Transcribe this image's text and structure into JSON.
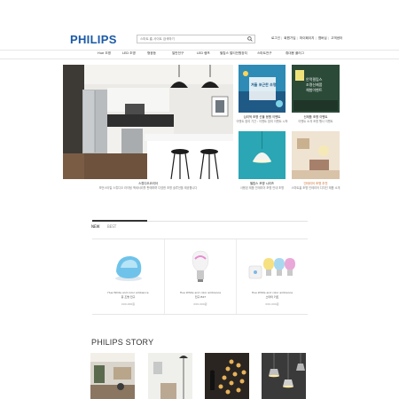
{
  "header": {
    "logo": "PHILIPS",
    "search_placeholder": "스마트 홈 사이트 검색하기",
    "util_links": [
      "로그인",
      "회원가입",
      "마이페이지",
      "멤버십",
      "고객센터"
    ]
  },
  "nav": {
    "items": [
      "Hue 조명",
      "LED 조명",
      "형광등",
      "일반전구",
      "LED 램프",
      "필립스 멀티전원장치",
      "스마트전구",
      "휴대용 플러그"
    ]
  },
  "hero": {
    "title": "스튜디오코리아",
    "desc": "모던스타일 스튜디오 라이팅 액세서리를 판매하며 다양한 조명 솔루션을 제공합니다"
  },
  "side_promos": [
    {
      "title": "심리적 조명 선물 응원 이벤트",
      "desc": "이벤트 참여 기간 : 이벤트 참여 이벤트 시작",
      "banner": "겨울 포근한 조명"
    },
    {
      "title": "신제품 조명 이벤트",
      "desc": "이벤트 소개 조명 행사 이벤트",
      "banner_lines": [
        "안락필립스",
        "조명신제품",
        "체험이벤트"
      ]
    },
    {
      "title": "필립스 조명 시리즈",
      "desc": "사용된 제품 인테리어 조명 안내 조명",
      "banner": ""
    },
    {
      "title": "인테리어 조명 추천",
      "desc": "스마트홈 조명 인테리어 디자인 제품 소개",
      "banner": ""
    }
  ],
  "tabs": [
    "NEW",
    "BEST"
  ],
  "products": [
    {
      "name": "Hue White and color ambiance",
      "sub": "휴 조명 전구",
      "price": "000,000원"
    },
    {
      "name": "Hue White and color ambiance",
      "sub": "전구 E27",
      "price": "000,000원"
    },
    {
      "name": "Hue White and color ambiance",
      "sub": "스타터 키트",
      "price": "000,000원"
    }
  ],
  "story": {
    "title": "PHILIPS STORY"
  },
  "colors": {
    "brand": "#1a5aa8",
    "promo_teal": "#2aa6b4",
    "promo_dark": "#2b4a38"
  }
}
